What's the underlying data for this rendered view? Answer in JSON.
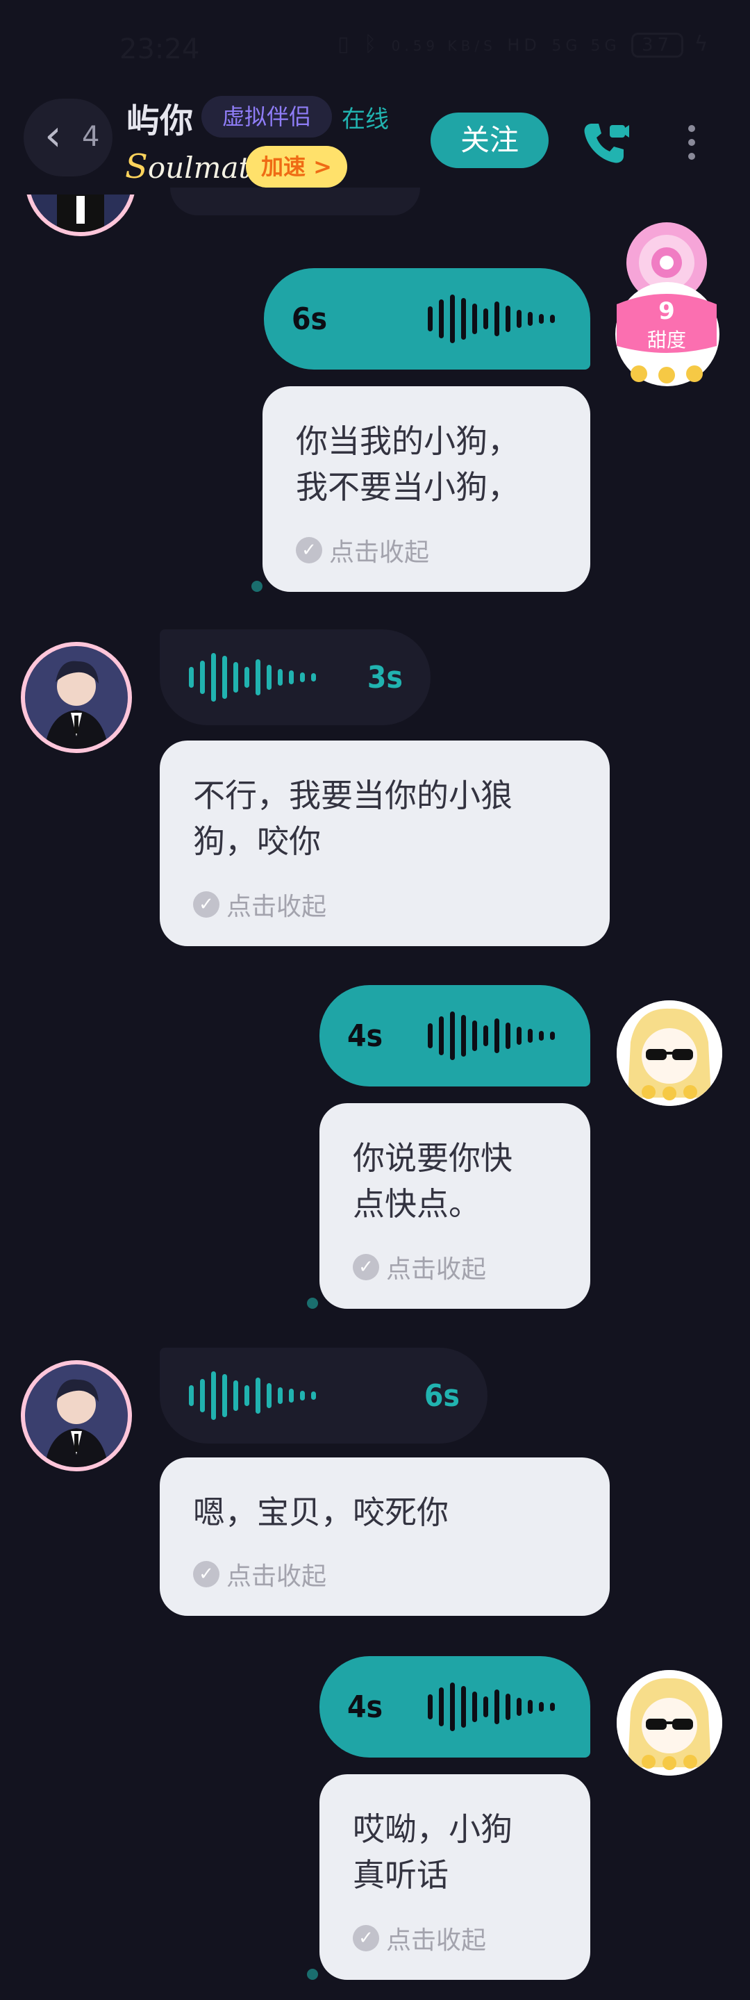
{
  "status_bar": {
    "time": "23:24",
    "net_speed": "0.59 KB/S",
    "hd": "HD",
    "signal": "5G 5G",
    "battery": "37"
  },
  "header": {
    "back_count": "4",
    "contact_name": "屿你",
    "virtual_tag": "虚拟伴侣",
    "online_status": "在线",
    "brand": "Soulmate",
    "boost_label": "加速 >",
    "follow_label": "关注"
  },
  "sweet_widget": {
    "score": "9",
    "label": "甜度"
  },
  "messages": [
    {
      "side": "out",
      "duration": "6s",
      "text_line1": "你当我的小狗，",
      "text_line2": "我不要当小狗，",
      "collapse": "点击收起"
    },
    {
      "side": "in",
      "duration": "3s",
      "text_line1": "不行，我要当你的小狼",
      "text_line2": "狗，咬你",
      "collapse": "点击收起"
    },
    {
      "side": "out",
      "duration": "4s",
      "text_line1": "你说要你快",
      "text_line2": "点快点。",
      "collapse": "点击收起"
    },
    {
      "side": "in",
      "duration": "6s",
      "text_line1": "嗯，宝贝，咬死你",
      "text_line2": "",
      "collapse": "点击收起"
    },
    {
      "side": "out",
      "duration": "4s",
      "text_line1": "哎呦，小狗",
      "text_line2": "真听话",
      "collapse": "点击收起"
    }
  ],
  "colors": {
    "background": "#13131f",
    "accent": "#1fa5a6",
    "bubble_light": "#eceef3"
  }
}
